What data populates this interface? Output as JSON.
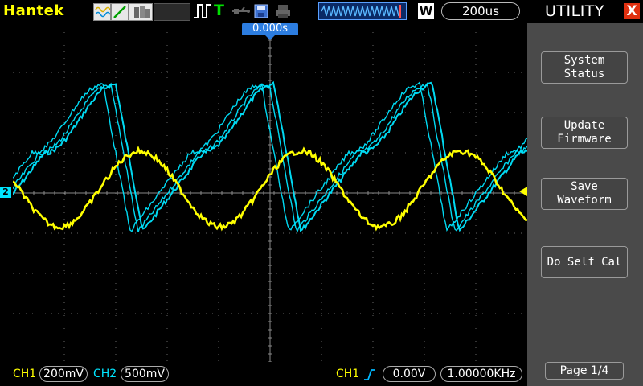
{
  "brand": "Hantek",
  "topbar": {
    "icons": [
      "waveform-display-icon",
      "vector-line-icon",
      "persistence-icon",
      "trigger-edge-icon",
      "trigger-status-icon",
      "usb-icon",
      "save-disk-icon",
      "printer-icon",
      "memory-waveform-icon"
    ],
    "trigger_status": "T",
    "mode_badge": "W",
    "timebase": "200us"
  },
  "screen": {
    "trigger_position": "0.000s",
    "ch2_marker": "2",
    "colors": {
      "ch1": "#ffff00",
      "ch2": "#00e5ff",
      "grid": "#666666"
    }
  },
  "status": {
    "ch1_label": "CH1",
    "ch1_scale": "200mV",
    "ch2_label": "CH2",
    "ch2_scale": "500mV",
    "trig_source": "CH1",
    "trig_level": "0.00V",
    "trig_freq": "1.00000KHz"
  },
  "panel": {
    "title": "UTILITY",
    "close": "X",
    "buttons": [
      {
        "line1": "System",
        "line2": "Status"
      },
      {
        "line1": "Update",
        "line2": "Firmware"
      },
      {
        "line1": "Save",
        "line2": "Waveform"
      },
      {
        "line1": "Do Self Cal",
        "line2": ""
      }
    ],
    "page": "Page 1/4"
  }
}
